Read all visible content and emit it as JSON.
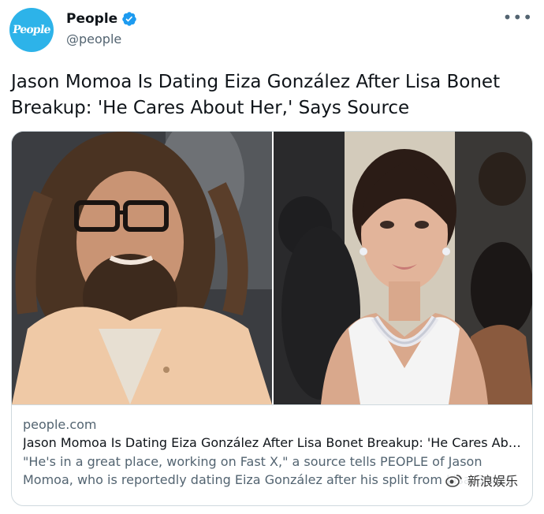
{
  "tweet": {
    "display_name": "People",
    "handle": "@people",
    "avatar_text": "People",
    "more_icon": "more-icon",
    "text": "Jason Momoa Is Dating Eiza González After Lisa Bonet Breakup: 'He Cares About Her,' Says Source"
  },
  "card": {
    "domain": "people.com",
    "title": "Jason Momoa Is Dating Eiza González After Lisa Bonet Breakup: 'He Cares Abo...",
    "description": "\"He's in a great place, working on Fast X,\" a source tells PEOPLE of Jason Momoa, who is reportedly dating Eiza González after his split from Lisa Bonet"
  },
  "watermark": {
    "text": "新浪娱乐"
  },
  "colors": {
    "avatar_bg": "#2db3e9",
    "verified": "#1d9bf0",
    "text_primary": "#0f1419",
    "text_secondary": "#536471"
  }
}
